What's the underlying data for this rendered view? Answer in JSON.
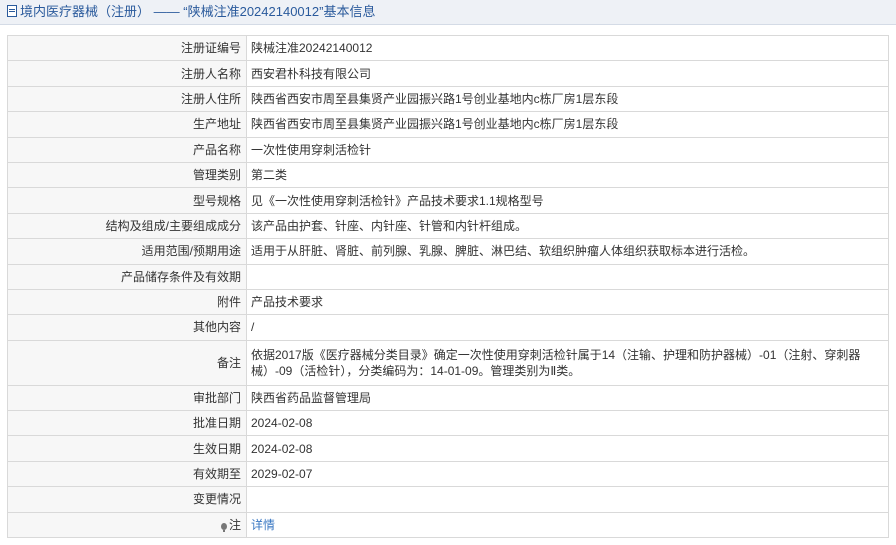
{
  "header": {
    "category": "境内医疗器械（注册）",
    "separator": "——",
    "title": "“陕械注准20242140012”基本信息"
  },
  "rows": [
    {
      "label": "注册证编号",
      "value": "陕械注准20242140012"
    },
    {
      "label": "注册人名称",
      "value": "西安君朴科技有限公司"
    },
    {
      "label": "注册人住所",
      "value": "陕西省西安市周至县集贤产业园振兴路1号创业基地内c栋厂房1层东段"
    },
    {
      "label": "生产地址",
      "value": "陕西省西安市周至县集贤产业园振兴路1号创业基地内c栋厂房1层东段"
    },
    {
      "label": "产品名称",
      "value": "一次性使用穿刺活检针"
    },
    {
      "label": "管理类别",
      "value": "第二类"
    },
    {
      "label": "型号规格",
      "value": "见《一次性使用穿刺活检针》产品技术要求1.1规格型号"
    },
    {
      "label": "结构及组成/主要组成成分",
      "value": "该产品由护套、针座、内针座、针管和内针杆组成。"
    },
    {
      "label": "适用范围/预期用途",
      "value": "适用于从肝脏、肾脏、前列腺、乳腺、脾脏、淋巴结、软组织肿瘤人体组织获取标本进行活检。"
    },
    {
      "label": "产品储存条件及有效期",
      "value": ""
    },
    {
      "label": "附件",
      "value": "产品技术要求"
    },
    {
      "label": "其他内容",
      "value": "/"
    },
    {
      "label": "备注",
      "value": "依据2017版《医疗器械分类目录》确定一次性使用穿刺活检针属于14（注输、护理和防护器械）-01（注射、穿刺器械）-09（活检针），分类编码为：14-01-09。管理类别为Ⅱ类。"
    },
    {
      "label": "审批部门",
      "value": "陕西省药品监督管理局"
    },
    {
      "label": "批准日期",
      "value": "2024-02-08"
    },
    {
      "label": "生效日期",
      "value": "2024-02-08"
    },
    {
      "label": "有效期至",
      "value": "2029-02-07"
    },
    {
      "label": "变更情况",
      "value": ""
    }
  ],
  "note": {
    "label": "注",
    "link_text": "详情",
    "icon": "lightbulb-icon"
  }
}
